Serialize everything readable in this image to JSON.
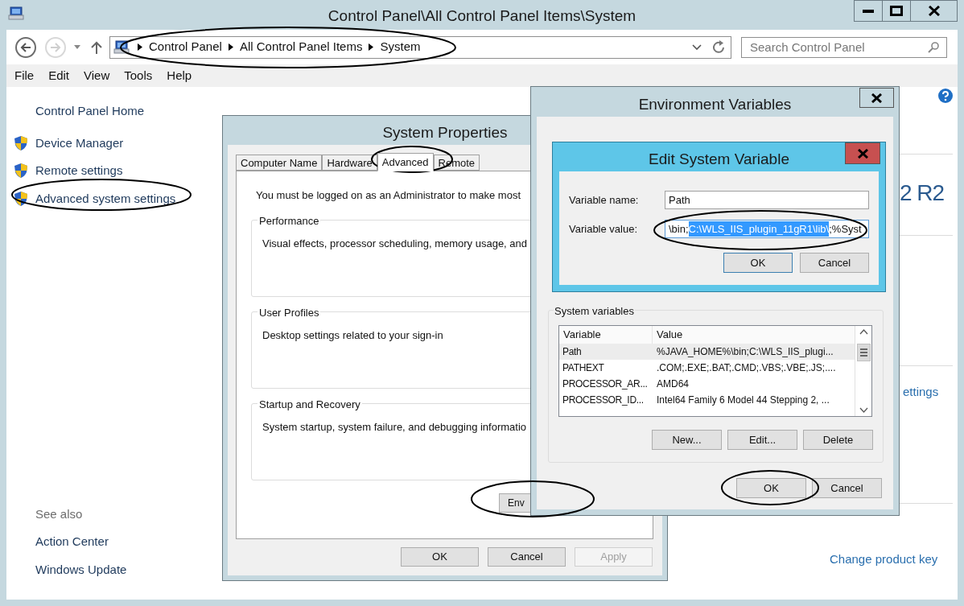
{
  "main_window": {
    "title": "Control Panel\\All Control Panel Items\\System",
    "breadcrumb": [
      "Control Panel",
      "All Control Panel Items",
      "System"
    ],
    "search": {
      "placeholder": "Search Control Panel"
    },
    "menu": [
      "File",
      "Edit",
      "View",
      "Tools",
      "Help"
    ],
    "sidebar": {
      "home": "Control Panel Home",
      "items": [
        {
          "label": "Device Manager"
        },
        {
          "label": "Remote settings"
        },
        {
          "label": "Advanced system settings"
        }
      ],
      "see_also_title": "See also",
      "see_also": [
        "Action Center",
        "Windows Update"
      ]
    },
    "content": {
      "edition_fragment": "2 R2",
      "link_fragment": "ettings",
      "product_key_link": "Change product key"
    }
  },
  "system_properties": {
    "title": "System Properties",
    "tabs": [
      {
        "label": "Computer Name",
        "selected": false
      },
      {
        "label": "Hardware",
        "selected": false
      },
      {
        "label": "Advanced",
        "selected": true
      },
      {
        "label": "Remote",
        "selected": false
      }
    ],
    "notice": "You must be logged on as an Administrator to make most",
    "groups": [
      {
        "title": "Performance",
        "text": "Visual effects, processor scheduling, memory usage, and"
      },
      {
        "title": "User Profiles",
        "text": "Desktop settings related to your sign-in"
      },
      {
        "title": "Startup and Recovery",
        "text": "System startup, system failure, and debugging informatio"
      }
    ],
    "environment_button": "Env",
    "buttons": [
      {
        "label": "OK",
        "disabled": false
      },
      {
        "label": "Cancel",
        "disabled": false
      },
      {
        "label": "Apply",
        "disabled": true
      }
    ]
  },
  "environment_variables": {
    "title": "Environment Variables",
    "system_variables": {
      "title": "System variables",
      "columns": [
        "Variable",
        "Value"
      ],
      "rows": [
        {
          "variable": "Path",
          "value": "%JAVA_HOME%\\bin;C:\\WLS_IIS_plugi...",
          "selected": true
        },
        {
          "variable": "PATHEXT",
          "value": ".COM;.EXE;.BAT;.CMD;.VBS;.VBE;.JS;....",
          "selected": false
        },
        {
          "variable": "PROCESSOR_AR...",
          "value": "AMD64",
          "selected": false
        },
        {
          "variable": "PROCESSOR_ID...",
          "value": "Intel64 Family 6 Model 44 Stepping 2, ...",
          "selected": false
        }
      ],
      "buttons": [
        "New...",
        "Edit...",
        "Delete"
      ]
    },
    "buttons": [
      "OK",
      "Cancel"
    ]
  },
  "edit_system_variable": {
    "title": "Edit System Variable",
    "name_label": "Variable name:",
    "name_value": "Path",
    "value_label": "Variable value:",
    "value_before": "\\bin;",
    "value_selected": "C:\\WLS_IIS_plugin_11gR1\\lib\\",
    "value_after": ";%Syst",
    "buttons": [
      "OK",
      "Cancel"
    ]
  }
}
